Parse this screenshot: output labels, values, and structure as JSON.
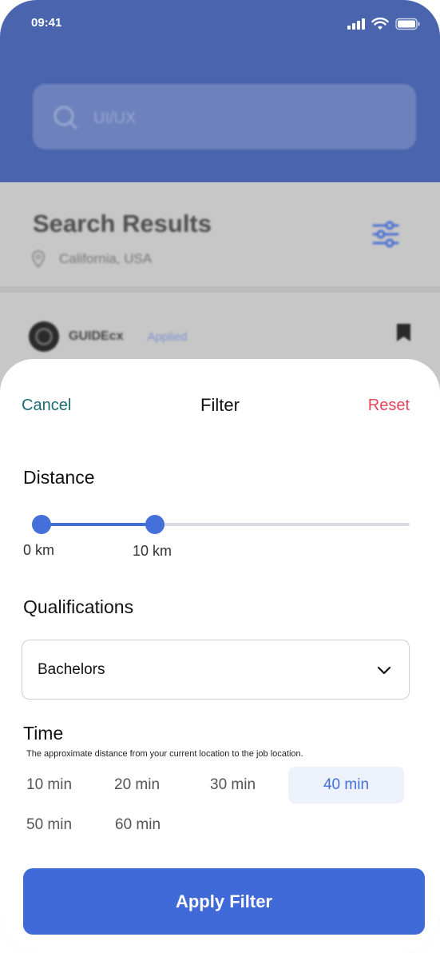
{
  "status_bar": {
    "time": "09:41"
  },
  "background": {
    "search_query": "UI/UX",
    "title": "Search Results",
    "location": "California, USA",
    "company": "GUIDEcx",
    "applied_badge": "Applied",
    "header_color": "#4a65ad"
  },
  "sheet": {
    "cancel_label": "Cancel",
    "title": "Filter",
    "reset_label": "Reset",
    "distance": {
      "title": "Distance",
      "min_label": "0 km",
      "max_label": "10 km",
      "range_fraction": 0.307
    },
    "qualifications": {
      "title": "Qualifications",
      "selected": "Bachelors"
    },
    "time": {
      "title": "Time",
      "subtitle": "The approximate distance from your current location to the job location.",
      "options": [
        "10 min",
        "20 min",
        "30 min",
        "40 min",
        "50 min",
        "60 min"
      ],
      "selected": "40 min"
    },
    "apply_label": "Apply Filter"
  },
  "colors": {
    "accent": "#416ad9",
    "cancel": "#1b6b73",
    "reset": "#e6455c",
    "selected_bg": "#ecf1fb"
  }
}
